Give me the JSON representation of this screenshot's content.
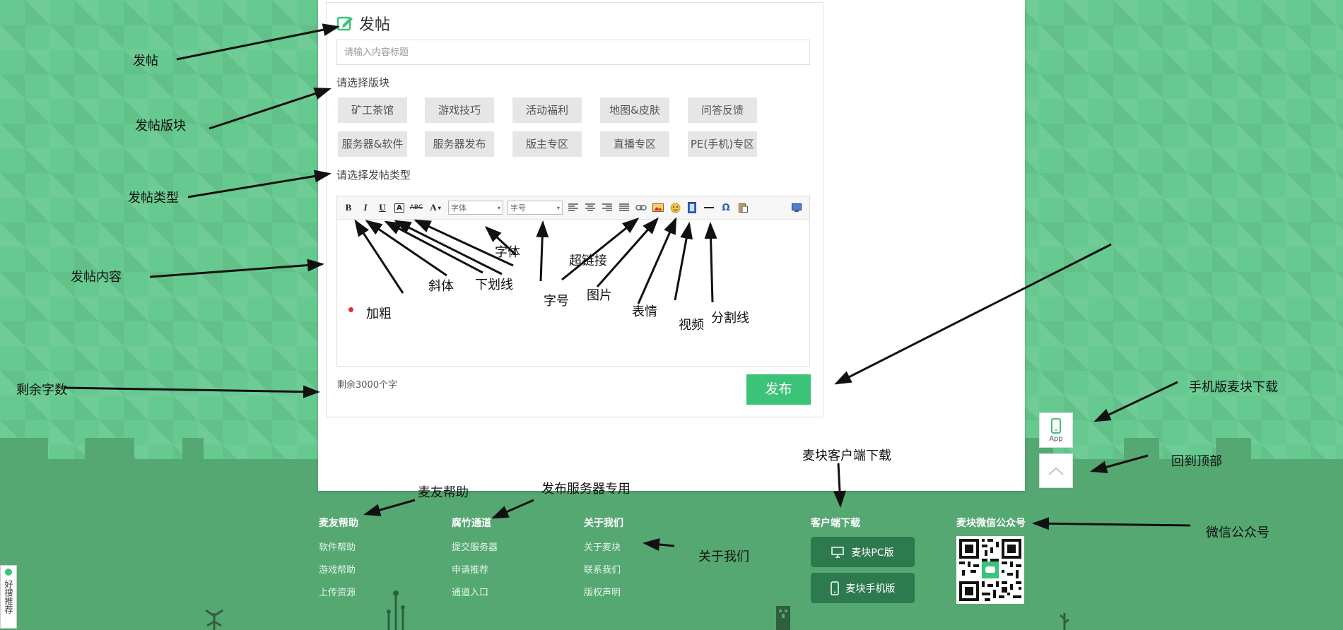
{
  "compose": {
    "title": "发帖",
    "title_placeholder": "请输入内容标题",
    "board_label": "请选择版块",
    "boards": [
      "矿工茶馆",
      "游戏技巧",
      "活动福利",
      "地图&皮肤",
      "问答反馈",
      "服务器&软件",
      "服务器发布",
      "版主专区",
      "直播专区",
      "PE(手机)专区"
    ],
    "type_label": "请选择发帖类型",
    "font_family_select": "字体",
    "font_size_select": "字号",
    "remaining": "剩余3000个字",
    "publish": "发布"
  },
  "toolbar_icons": [
    "bold-icon",
    "italic-icon",
    "underline-icon",
    "font-border-icon",
    "strikethrough-icon",
    "font-color-icon",
    "align-left-icon",
    "align-center-icon",
    "align-right-icon",
    "align-justify-icon",
    "link-icon",
    "image-icon",
    "emoji-icon",
    "video-icon",
    "divider-icon",
    "special-char-icon",
    "paste-icon",
    "source-icon"
  ],
  "side": {
    "app_label": "App"
  },
  "footer": {
    "columns": [
      {
        "title": "麦友帮助",
        "links": [
          "软件帮助",
          "游戏帮助",
          "上传资源"
        ]
      },
      {
        "title": "腐竹通道",
        "links": [
          "提交服务器",
          "申请推荐",
          "通道入口"
        ]
      },
      {
        "title": "关于我们",
        "links": [
          "关于麦块",
          "联系我们",
          "版权声明"
        ]
      }
    ],
    "client_title": "客户端下载",
    "pc_button": "麦块PC版",
    "mobile_button": "麦块手机版",
    "wechat_title": "麦块微信公众号"
  },
  "side_tab": {
    "label": "好搜推荐"
  },
  "annotations": {
    "post": "发帖",
    "post_board": "发帖版块",
    "post_type": "发帖类型",
    "post_content": "发帖内容",
    "remaining_words": "剩余字数",
    "bold": "加粗",
    "italic": "斜体",
    "underline": "下划线",
    "font": "字体",
    "size": "字号",
    "hyperlink": "超链接",
    "image": "图片",
    "emoji": "表情",
    "video": "视频",
    "divider": "分割线",
    "mobile_download": "手机版麦块下载",
    "back_to_top": "回到顶部",
    "friend_help": "麦友帮助",
    "server_publish": "发布服务器专用",
    "client_download": "麦块客户端下载",
    "about_us": "关于我们",
    "wechat": "微信公众号"
  },
  "colors": {
    "accent": "#3cc37a",
    "bg_light": "#66c98f",
    "bg_dark": "#55a872",
    "button_dark": "#2e7a4f",
    "bullet": "#e03030"
  }
}
